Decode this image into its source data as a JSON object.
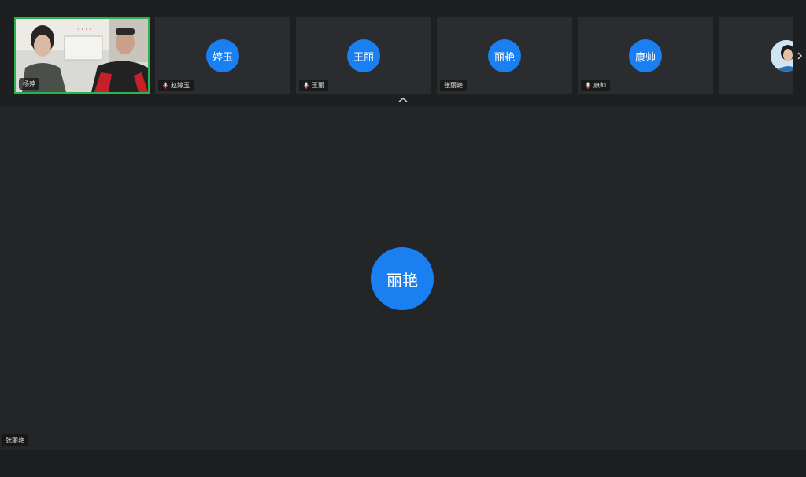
{
  "participants": [
    {
      "name": "杨萍",
      "avatar_text": "",
      "video": true,
      "active": true,
      "mic_icon": false
    },
    {
      "name": "赵婷玉",
      "avatar_text": "婷玉",
      "video": false,
      "mic_icon": true
    },
    {
      "name": "王丽",
      "avatar_text": "王丽",
      "video": false,
      "mic_icon": true
    },
    {
      "name": "张丽艳",
      "avatar_text": "丽艳",
      "video": false,
      "mic_icon": false
    },
    {
      "name": "康帅",
      "avatar_text": "康帅",
      "video": false,
      "mic_icon": true
    }
  ],
  "stage": {
    "avatar_text": "丽艳",
    "name": "张丽艳"
  },
  "colors": {
    "avatar_blue": "#1a7ff0",
    "active_border": "#2bb24c"
  },
  "icons": {
    "collapse": "chevron-up-icon",
    "next": "chevron-right-icon",
    "mic": "mic-icon"
  }
}
